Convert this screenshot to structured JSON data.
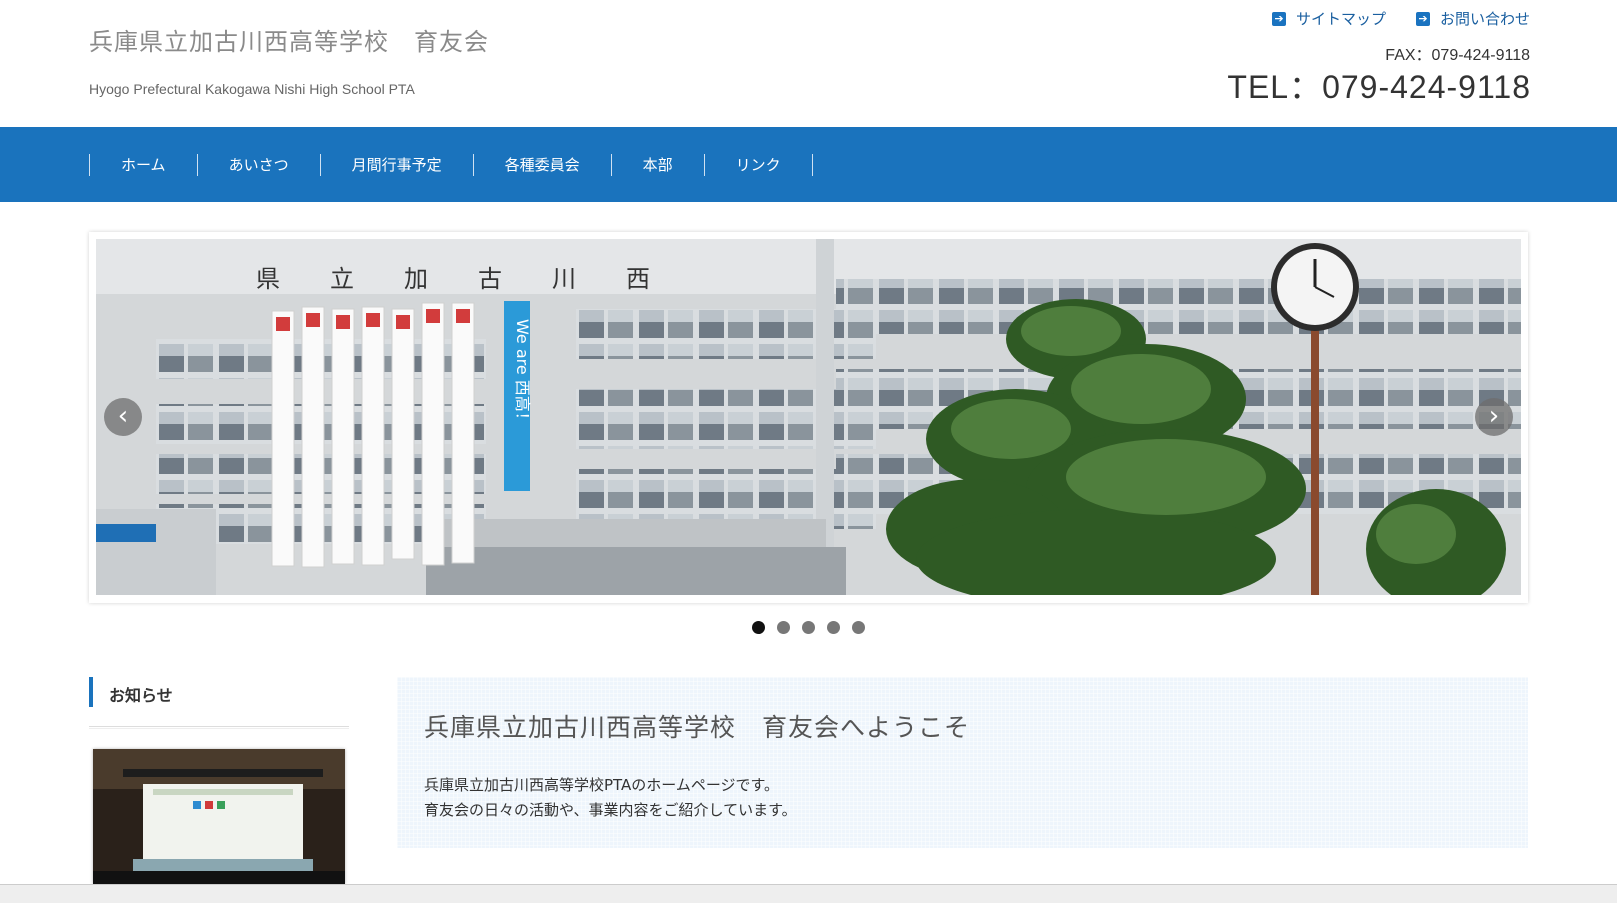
{
  "header": {
    "title": "兵庫県立加古川西高等学校　育友会",
    "subtitle": "Hyogo Prefectural Kakogawa Nishi High School PTA",
    "links": [
      {
        "label": "サイトマップ",
        "icon": "arrow-right-icon"
      },
      {
        "label": "お問い合わせ",
        "icon": "arrow-right-icon"
      }
    ],
    "fax": "FAX：079-424-9118",
    "tel": "TEL：079-424-9118"
  },
  "nav": {
    "items": [
      "ホーム",
      "あいさつ",
      "月間行事予定",
      "各種委員会",
      "本部",
      "リンク"
    ]
  },
  "slider": {
    "prev": "‹",
    "next": "›",
    "dots": 5,
    "active_dot": 1,
    "banner_text": "We are 西高！",
    "building_sign": "県立加古川西"
  },
  "sidebar": {
    "heading": "お知らせ"
  },
  "welcome": {
    "title": "兵庫県立加古川西高等学校　育友会へようこそ",
    "line1": "兵庫県立加古川西高等学校PTAのホームページです。",
    "line2": "育友会の日々の活動や、事業内容をご紹介しています。"
  },
  "colors": {
    "nav_bg": "#1a73bd",
    "accent": "#1a73bd",
    "welcome_bg": "#eef5fc"
  }
}
